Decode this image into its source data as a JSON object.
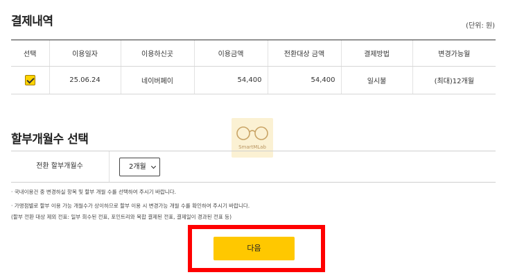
{
  "payment_history": {
    "title": "결제내역",
    "unit": "(단위: 원)",
    "columns": [
      "선택",
      "이용일자",
      "이용하신곳",
      "이용금액",
      "전환대상 금액",
      "결제방법",
      "변경가능월"
    ],
    "rows": [
      {
        "selected": true,
        "date": "25.06.24",
        "merchant": "네이버페이",
        "amount": "54,400",
        "convertible_amount": "54,400",
        "payment_method": "일시불",
        "available_months": "(최대)12개월"
      }
    ]
  },
  "installment": {
    "title": "할부개월수 선택",
    "field_label": "전환 할부개월수",
    "selected_value": "2개월"
  },
  "notes": [
    "· 국내이용건 중 변경하실 항목 및 할부 개월 수를 선택하여 주시기 바랍니다.",
    "· 가맹점별로 할부 이용 가능 개월수가 상이하므로 할부 이용 시 변경가능 개월 수를 확인하여 주시기 바랍니다.",
    "(할부 전환 대상 제외 전표: 일부 회수된 전표, 포인트리와 복합 결제된 전표, 결제일이 경과된 전표 등)"
  ],
  "watermark": {
    "text": "SmartMLab",
    "icon": "glasses-icon"
  },
  "next_button": {
    "label": "다음"
  },
  "colors": {
    "accent_yellow": "#ffc800",
    "highlight_red": "#ff0000",
    "watermark_bg": "#fbf1d3"
  }
}
